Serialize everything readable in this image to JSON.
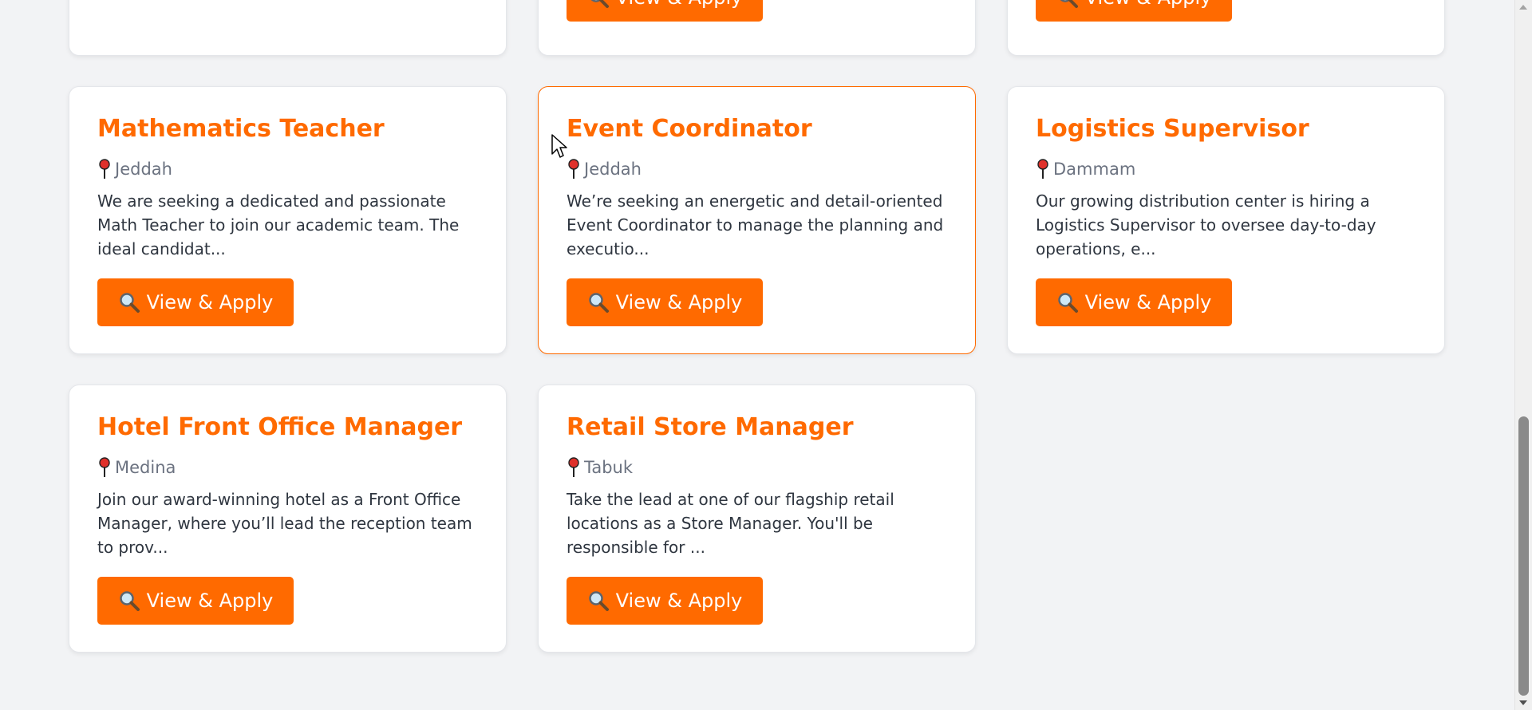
{
  "colors": {
    "accent": "#ff6a00",
    "background": "#f2f3f5",
    "card": "#ffffff"
  },
  "jobs": [
    {
      "title": "Mathematics Teacher",
      "location": "Jeddah",
      "description": "We are seeking a dedicated and passionate Math Teacher to join our academic team. The ideal candidat...",
      "button": "View & Apply"
    },
    {
      "title": "Event Coordinator",
      "location": "Jeddah",
      "description": "We’re seeking an energetic and detail-oriented Event Coordinator to manage the planning and executio...",
      "button": "View & Apply",
      "state": "hovered"
    },
    {
      "title": "Logistics Supervisor",
      "location": "Dammam",
      "description": "Our growing distribution center is hiring a Logistics Supervisor to oversee day-to-day operations, e...",
      "button": "View & Apply"
    },
    {
      "title": "Hotel Front Office Manager",
      "location": "Medina",
      "description": "Join our award-winning hotel as a Front Office Manager, where you’ll lead the reception team to prov...",
      "button": "View & Apply"
    },
    {
      "title": "Retail Store Manager",
      "location": "Tabuk",
      "description": "Take the lead at one of our flagship retail locations as a Store Manager. You'll be responsible for ...",
      "button": "View & Apply"
    }
  ],
  "partial_top_row": [
    {
      "button": "View & Apply"
    },
    {
      "button": "View & Apply"
    }
  ],
  "icons": {
    "location": "pin-icon",
    "button": "search-icon"
  }
}
